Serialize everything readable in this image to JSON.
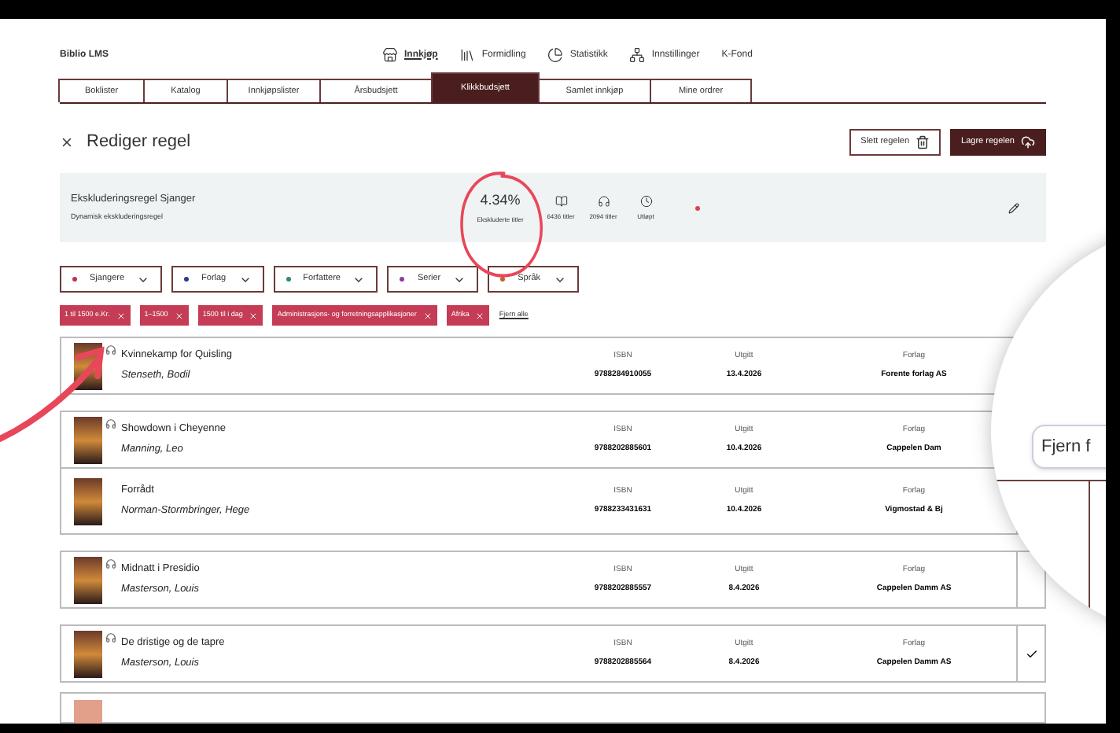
{
  "app_name": "Biblio LMS",
  "nav": [
    {
      "label": "Innkjøp",
      "selected": true
    },
    {
      "label": "Formidling",
      "selected": false
    },
    {
      "label": "Statistikk",
      "selected": false
    },
    {
      "label": "Innstillinger",
      "selected": false
    },
    {
      "label": "K-Fond",
      "selected": false
    }
  ],
  "tabs": [
    {
      "label": "Boklister",
      "selected": false
    },
    {
      "label": "Katalog",
      "selected": false
    },
    {
      "label": "Innkjøpslister",
      "selected": false
    },
    {
      "label": "Årsbudsjett",
      "selected": false
    },
    {
      "label": "Klikkbudsjett",
      "selected": true
    },
    {
      "label": "Samlet innkjøp",
      "selected": false
    },
    {
      "label": "Mine ordrer",
      "selected": false
    }
  ],
  "page_title": "Rediger regel",
  "buttons": [
    {
      "label": "Slett regelen",
      "kind": "secondary"
    },
    {
      "label": "Lagre regelen",
      "kind": "primary"
    }
  ],
  "rule": {
    "name": "Ekskluderingsregel Sjanger",
    "type": "Dynamisk ekskluderingsregel",
    "percent": "4.34%",
    "percent_label": "Ekskluderte titler",
    "stats": [
      "6436 titler",
      "2094 titler",
      "Utløpt"
    ],
    "status_dot": {
      "color": "#e0404f"
    }
  },
  "filters": [
    {
      "label": "Sjangere",
      "color": "#c0334d"
    },
    {
      "label": "Forlag",
      "color": "#2a3a8c"
    },
    {
      "label": "Forfattere",
      "color": "#2e8a6e"
    },
    {
      "label": "Serier",
      "color": "#8a3aa0"
    },
    {
      "label": "Språk",
      "color": "#c0642a"
    }
  ],
  "chips": [
    "1 til 1500 e.Kr.",
    "1–1500",
    "1500 til i dag",
    "Administrasjons- og forretningsapplikasjoner",
    "Afrika"
  ],
  "clear_all": "Fjern alle",
  "books": [
    {
      "title": "Kvinnekamp for Quisling",
      "author": "Stenseth, Bodil",
      "isbn_label": "ISBN",
      "isbn": "9788284910055",
      "date_label": "Utgitt",
      "date": "13.4.2026",
      "publisher_label": "Forlag",
      "publisher": "Forente forlag AS",
      "audio": true,
      "kind": "card"
    },
    {
      "title": "Showdown i Cheyenne",
      "author": "Manning, Leo",
      "isbn_label": "ISBN",
      "isbn": "9788202885601",
      "date_label": "Utgitt",
      "date": "10.4.2026",
      "publisher_label": "Forlag",
      "publisher": "Cappelen Dam",
      "audio": true,
      "kind": "card"
    },
    {
      "title": "Forrådt",
      "author": "Norman-Stormbringer, Hege",
      "isbn_label": "ISBN",
      "isbn": "9788233431631",
      "date_label": "Utgitt",
      "date": "10.4.2026",
      "publisher_label": "Forlag",
      "publisher": "Vigmostad & Bj",
      "audio": false,
      "kind": "attached"
    },
    {
      "title": "Midnatt i Presidio",
      "author": "Masterson, Louis",
      "isbn_label": "ISBN",
      "isbn": "9788202885557",
      "date_label": "Utgitt",
      "date": "8.4.2026",
      "publisher_label": "Forlag",
      "publisher": "Cappelen Damm AS",
      "audio": true,
      "kind": "card"
    },
    {
      "title": "De dristige og de tapre",
      "author": "Masterson, Louis",
      "isbn_label": "ISBN",
      "isbn": "9788202885564",
      "date_label": "Utgitt",
      "date": "8.4.2026",
      "publisher_label": "Forlag",
      "publisher": "Cappelen Damm AS",
      "audio": true,
      "kind": "card",
      "checked": true
    }
  ],
  "magnifier": {
    "field_text": "Fjern f"
  }
}
